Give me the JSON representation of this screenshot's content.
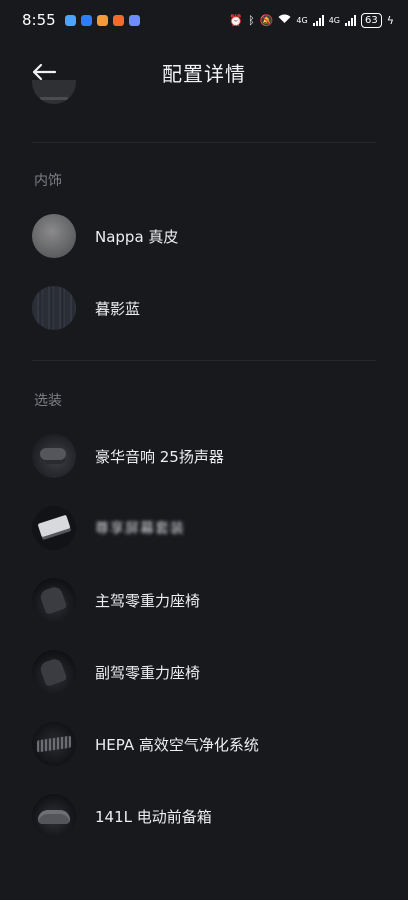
{
  "status_bar": {
    "time": "8:55",
    "signal_1": "4G",
    "signal_2": "4G",
    "battery": "63"
  },
  "header": {
    "title": "配置详情",
    "back_icon": "arrow-left-icon"
  },
  "sections": {
    "interior": {
      "label": "内饰",
      "items": [
        {
          "label": "Nappa 真皮"
        },
        {
          "label": "暮影蓝"
        }
      ]
    },
    "options": {
      "label": "选装",
      "items": [
        {
          "label": "豪华音响 25扬声器"
        },
        {
          "label": "尊享屏幕套装"
        },
        {
          "label": "主驾零重力座椅"
        },
        {
          "label": "副驾零重力座椅"
        },
        {
          "label": "HEPA 高效空气净化系统"
        },
        {
          "label": "141L 电动前备箱"
        }
      ]
    }
  },
  "colors": {
    "background": "#17191d",
    "text_primary": "#eeeef0",
    "text_secondary": "#7c7e84",
    "divider": "#26282c"
  }
}
